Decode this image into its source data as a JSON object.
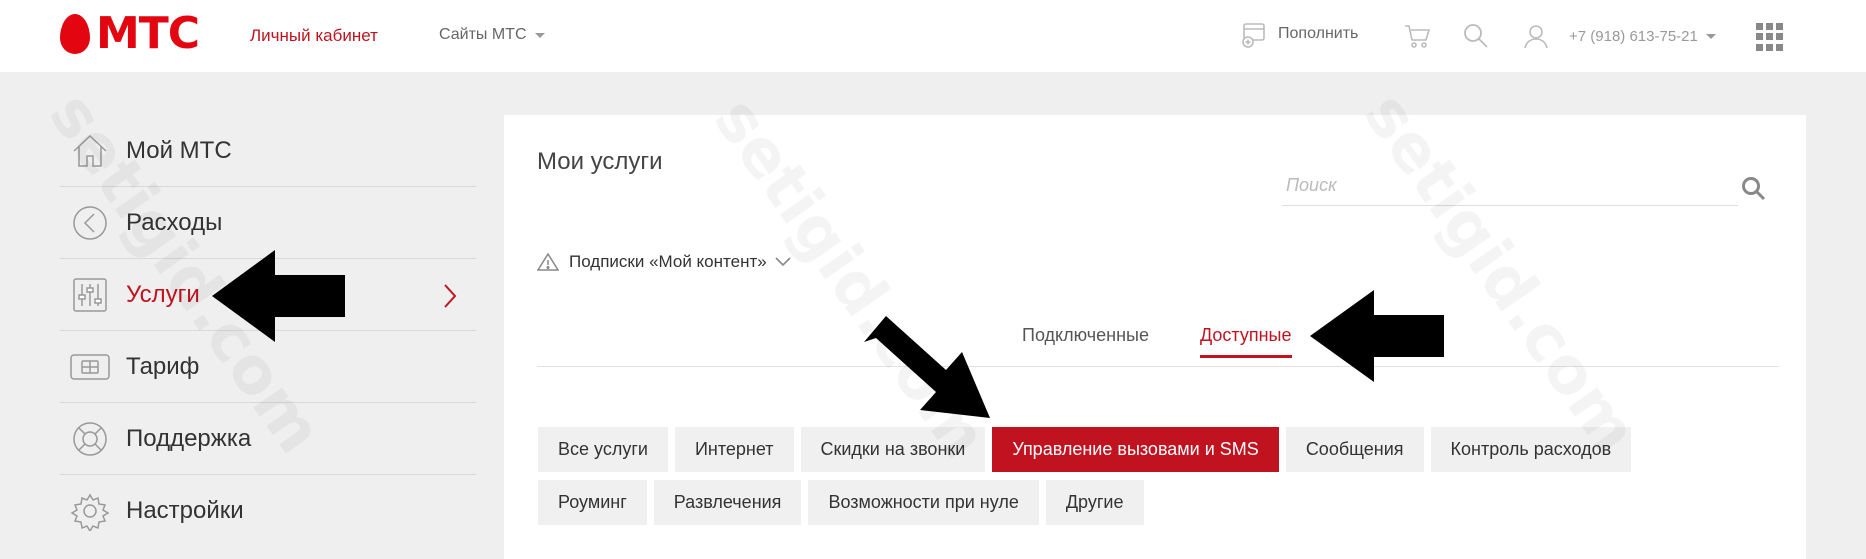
{
  "header": {
    "logo_text": "МТС",
    "cabinet_label": "Личный кабинет",
    "sites_label": "Сайты МТС",
    "topup_label": "Пополнить",
    "phone": "+7 (918) 613-75-21"
  },
  "sidebar": {
    "items": [
      {
        "label": "Мой МТС",
        "icon": "home-icon"
      },
      {
        "label": "Расходы",
        "icon": "expenses-icon"
      },
      {
        "label": "Услуги",
        "icon": "sliders-icon",
        "active": true
      },
      {
        "label": "Тариф",
        "icon": "sim-card-icon"
      },
      {
        "label": "Поддержка",
        "icon": "lifebuoy-icon"
      },
      {
        "label": "Настройки",
        "icon": "gear-icon"
      }
    ]
  },
  "main": {
    "title": "Мои услуги",
    "search_placeholder": "Поиск",
    "subscriptions_label": "Подписки «Мой контент»",
    "tabs": [
      {
        "label": "Подключенные",
        "active": false
      },
      {
        "label": "Доступные",
        "active": true
      }
    ],
    "filters_row1": [
      {
        "label": "Все услуги"
      },
      {
        "label": "Интернет"
      },
      {
        "label": "Скидки на звонки"
      },
      {
        "label": "Управление вызовами и SMS",
        "active": true
      },
      {
        "label": "Сообщения"
      },
      {
        "label": "Контроль расходов"
      }
    ],
    "filters_row2": [
      {
        "label": "Роуминг"
      },
      {
        "label": "Развлечения"
      },
      {
        "label": "Возможности при нуле"
      },
      {
        "label": "Другие"
      }
    ]
  },
  "watermark": "setigid.com",
  "colors": {
    "brand_red": "#e30611",
    "accent_red": "#c1121f",
    "chip_bg": "#f0f0f0",
    "page_bg": "#efefef"
  }
}
